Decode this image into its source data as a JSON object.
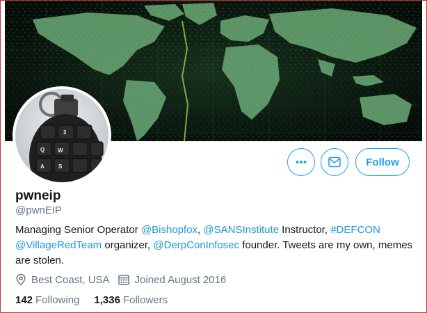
{
  "profile": {
    "display_name": "pwneip",
    "handle": "@pwnEIP",
    "bio": {
      "t1": "Managing Senior Operator ",
      "m1": "@Bishopfox",
      "t2": ", ",
      "m2": "@SANSInstitute",
      "t3": " Instructor, ",
      "m3": "#DEFCON",
      "t4": " ",
      "m4": "@VillageRedTeam",
      "t5": " organizer, ",
      "m5": "@DerpConInfosec",
      "t6": " founder. Tweets are my own, memes are stolen."
    },
    "location": "Best Coast, USA",
    "joined": "Joined August 2016"
  },
  "stats": {
    "following_count": "142",
    "following_label": "Following",
    "followers_count": "1,336",
    "followers_label": "Followers"
  },
  "actions": {
    "follow_label": "Follow",
    "more_icon": "more-dots-icon",
    "message_icon": "envelope-icon"
  },
  "avatar": {
    "key_labels": [
      "2",
      "W",
      "Q",
      "A",
      "S"
    ]
  },
  "colors": {
    "accent": "#1da1f2",
    "mention": "#1b95e0",
    "secondary_text": "#657786",
    "primary_text": "#14171a",
    "banner_green": "#6fbf82"
  }
}
